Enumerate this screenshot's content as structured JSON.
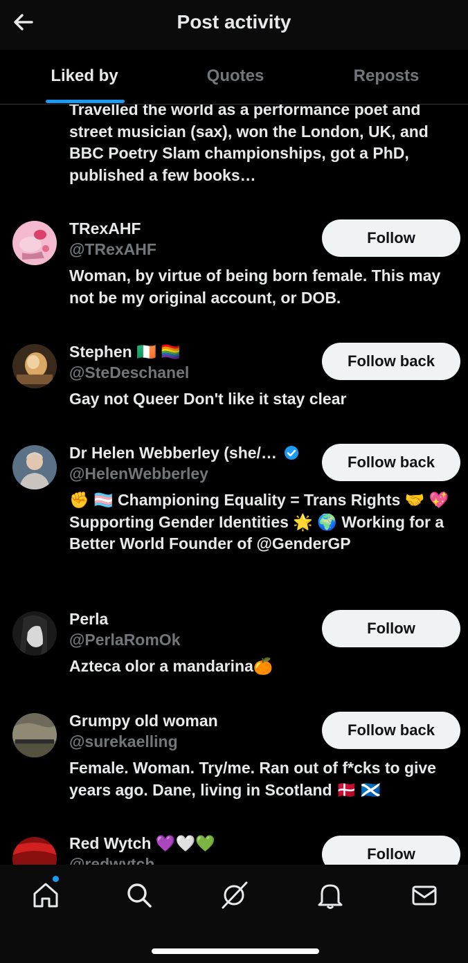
{
  "header": {
    "title": "Post activity"
  },
  "tabs": [
    {
      "label": "Liked by",
      "active": true
    },
    {
      "label": "Quotes",
      "active": false
    },
    {
      "label": "Reposts",
      "active": false
    }
  ],
  "top_bio": "Travelled the world as a performance poet and street musician (sax), won the London, UK, and BBC Poetry Slam championships, got a PhD, published a few books…",
  "users": [
    {
      "name": "TRexAHF",
      "handle": "@TRexAHF",
      "button": "Follow",
      "bio": "Woman, by virtue of being born female. This may not be my original account, or DOB."
    },
    {
      "name": "Stephen 🇮🇪 🏳️‍🌈",
      "handle": "@SteDeschanel",
      "button": "Follow back",
      "bio": "Gay not Queer Don't like it stay clear"
    },
    {
      "name": "Dr Helen Webberley (she/…",
      "handle": "@HelenWebberley",
      "button": "Follow back",
      "verified": true,
      "bio": "✊ 🏳️‍⚧️ Championing Equality = Trans Rights 🤝 💖 Supporting Gender Identities 🌟 🌍 Working for a Better World Founder of @GenderGP"
    },
    {
      "name": "Perla",
      "handle": "@PerlaRomOk",
      "button": "Follow",
      "bio": "Azteca olor a mandarina🍊"
    },
    {
      "name": "Grumpy old woman",
      "handle": "@surekaelling",
      "button": "Follow back",
      "bio": "Female. Woman. Try/me. Ran out of f*cks to give years ago. Dane, living in Scotland 🇩🇰 🏴󠁧󠁢󠁳󠁣󠁴󠁿"
    },
    {
      "name": "Red Wytch 💜🤍💚",
      "handle": "@redwytch",
      "button": "Follow",
      "bio": ""
    }
  ],
  "nav": [
    {
      "icon": "home-icon",
      "has_dot": true
    },
    {
      "icon": "search-icon"
    },
    {
      "icon": "grok-icon"
    },
    {
      "icon": "bell-icon"
    },
    {
      "icon": "mail-icon"
    }
  ],
  "colors": {
    "accent": "#1d9bf0",
    "muted": "#71767b",
    "button_bg": "#eff3f4"
  }
}
